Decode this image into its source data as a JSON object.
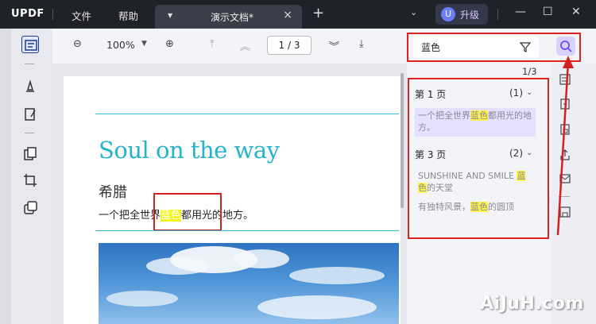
{
  "titlebar": {
    "logo": "UPDF",
    "menu_file": "文件",
    "menu_help": "帮助",
    "tab_title": "演示文档*",
    "tab_close": "×",
    "tab_add": "+",
    "upgrade_avatar": "U",
    "upgrade_label": "升级",
    "minimize": "—",
    "maximize": "☐",
    "close": "✕"
  },
  "toolbar": {
    "zoom": "100%",
    "page_indicator": "1 / 3"
  },
  "search": {
    "query": "蓝色",
    "count": "1/3"
  },
  "results": [
    {
      "page_label": "第 1 页",
      "count": "(1)",
      "items": [
        {
          "before": "一个把全世界",
          "match": "蓝色",
          "after": "都用光的地方。"
        }
      ]
    },
    {
      "page_label": "第 3 页",
      "count": "(2)",
      "items": [
        {
          "before": "SUNSHINE AND SMILE ",
          "match": "蓝色",
          "after": "的天堂"
        },
        {
          "before": "有独特风景，",
          "match": "蓝色",
          "after": "的圆顶"
        }
      ]
    }
  ],
  "document": {
    "title": "Soul on the way",
    "heading": "希腊",
    "line_before": "一个把全世界",
    "line_match": "蓝色",
    "line_after": "都用光的地方。"
  },
  "watermark": "AiJuH.com",
  "colors": {
    "accent": "#6b7cff",
    "doc_title": "#28b3cc",
    "highlight": "#fff34a",
    "annotation_red": "#e02020"
  }
}
